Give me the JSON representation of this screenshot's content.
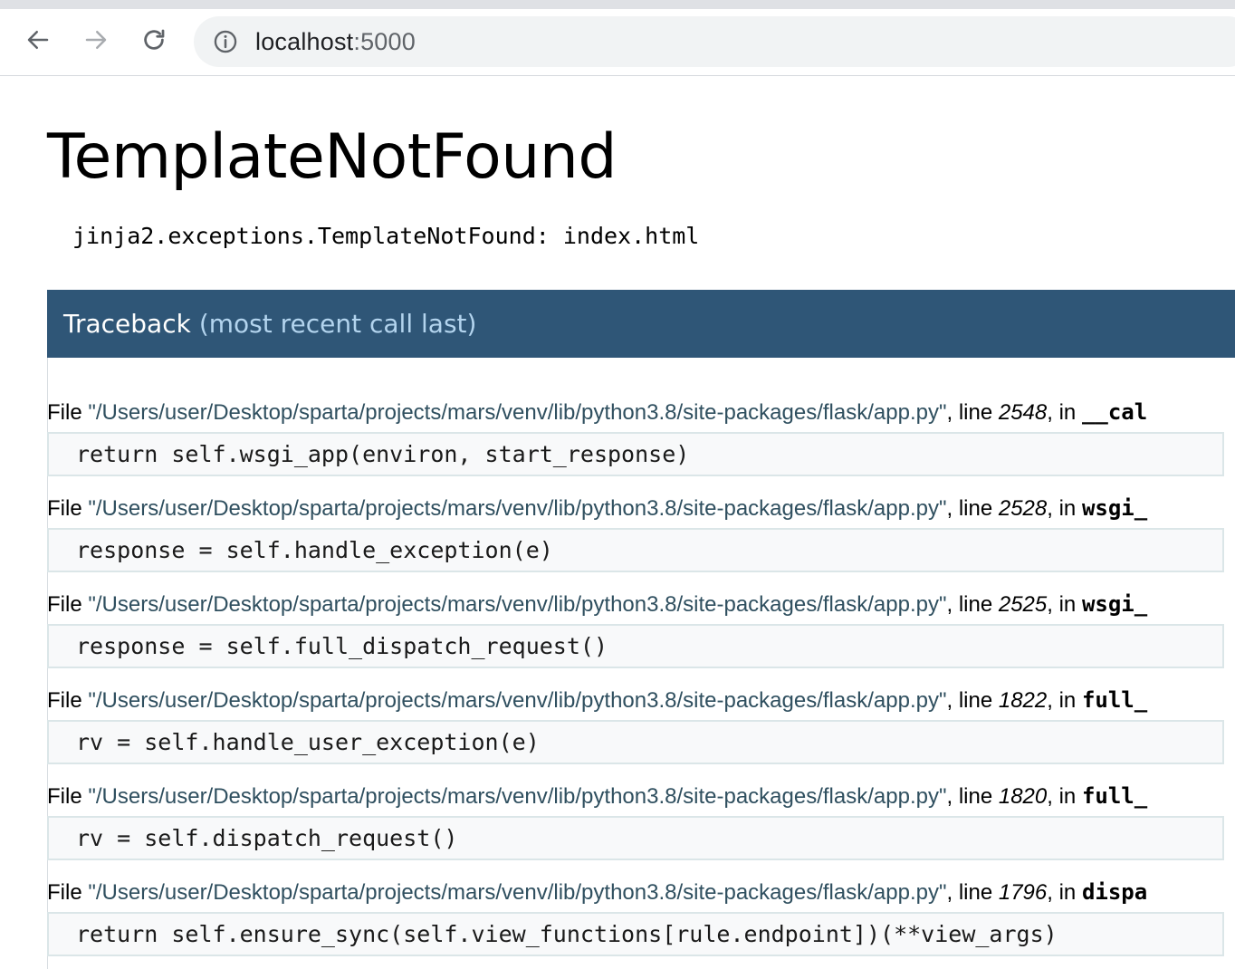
{
  "browser": {
    "url_host": "localhost",
    "url_port": ":5000"
  },
  "page": {
    "title": "TemplateNotFound",
    "message": "jinja2.exceptions.TemplateNotFound: index.html",
    "traceback_title": "Traceback",
    "traceback_subtitle": "(most recent call last)"
  },
  "frames": [
    {
      "file_prefix": "File ",
      "file": "\"/Users/user/Desktop/sparta/projects/mars/venv/lib/python3.8/site-packages/flask/app.py\"",
      "line_label": ", line ",
      "lineno": "2548",
      "in_label": ", in ",
      "func": "__cal",
      "code": "return self.wsgi_app(environ, start_response)"
    },
    {
      "file_prefix": "File ",
      "file": "\"/Users/user/Desktop/sparta/projects/mars/venv/lib/python3.8/site-packages/flask/app.py\"",
      "line_label": ", line ",
      "lineno": "2528",
      "in_label": ", in ",
      "func": "wsgi_",
      "code": "response = self.handle_exception(e)"
    },
    {
      "file_prefix": "File ",
      "file": "\"/Users/user/Desktop/sparta/projects/mars/venv/lib/python3.8/site-packages/flask/app.py\"",
      "line_label": ", line ",
      "lineno": "2525",
      "in_label": ", in ",
      "func": "wsgi_",
      "code": "response = self.full_dispatch_request()"
    },
    {
      "file_prefix": "File ",
      "file": "\"/Users/user/Desktop/sparta/projects/mars/venv/lib/python3.8/site-packages/flask/app.py\"",
      "line_label": ", line ",
      "lineno": "1822",
      "in_label": ", in ",
      "func": "full_",
      "code": "rv = self.handle_user_exception(e)"
    },
    {
      "file_prefix": "File ",
      "file": "\"/Users/user/Desktop/sparta/projects/mars/venv/lib/python3.8/site-packages/flask/app.py\"",
      "line_label": ", line ",
      "lineno": "1820",
      "in_label": ", in ",
      "func": "full_",
      "code": "rv = self.dispatch_request()"
    },
    {
      "file_prefix": "File ",
      "file": "\"/Users/user/Desktop/sparta/projects/mars/venv/lib/python3.8/site-packages/flask/app.py\"",
      "line_label": ", line ",
      "lineno": "1796",
      "in_label": ", in ",
      "func": "dispa",
      "code": "return self.ensure_sync(self.view_functions[rule.endpoint])(**view_args)"
    }
  ]
}
